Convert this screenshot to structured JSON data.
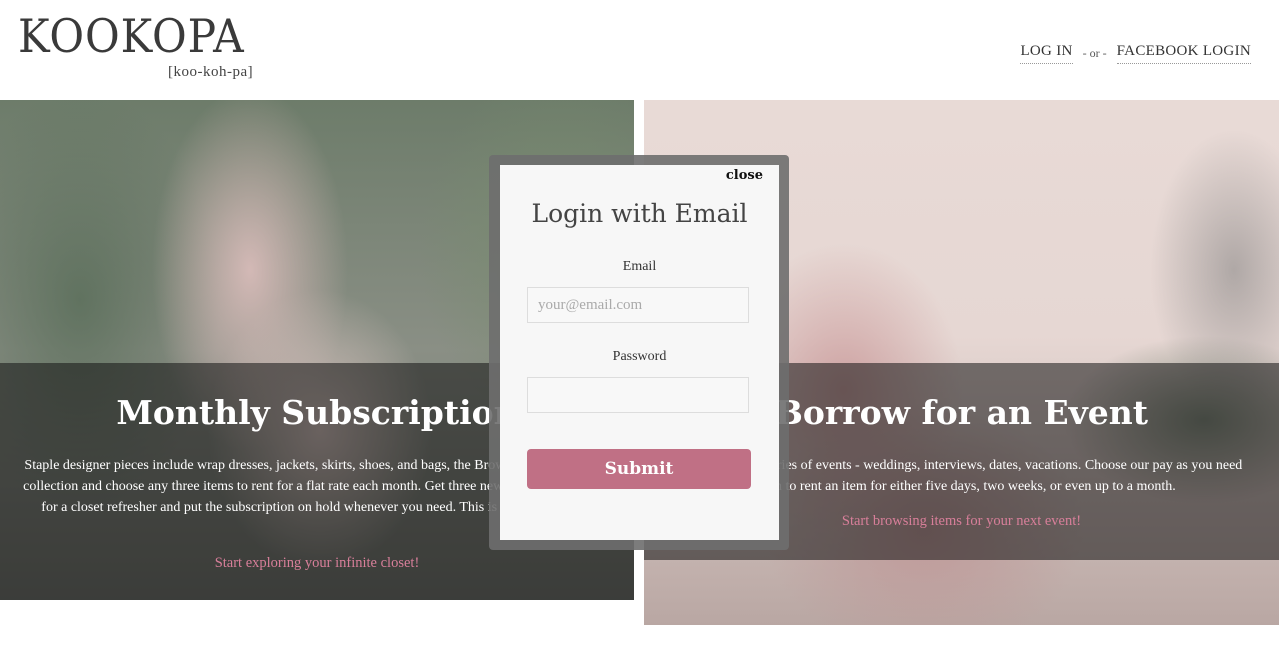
{
  "header": {
    "logo": "KOOKOPA",
    "logo_pronunciation": "[koo-koh-pa]",
    "nav": {
      "login": "LOG IN",
      "or": "- or -",
      "facebook_login": "FACEBOOK LOGIN"
    }
  },
  "panels": {
    "left": {
      "title": "Monthly Subscription",
      "text": "Staple designer pieces include wrap dresses, jackets, skirts, shoes, and bags, the Browse the subscription collection and choose any three items to rent for a flat rate each month. Get three new items every month for a closet refresher and put the subscription on hold whenever you need. This is your new closet.",
      "link": "Start exploring your infinite closet!"
    },
    "right": {
      "title": "Borrow for an Event",
      "text": "Life gives us a series of events - weddings, interviews, dates, vacations. Choose our pay as you need option to rent an item for either five days, two weeks, or even up to a month.",
      "link": "Start browsing items for your next event!"
    }
  },
  "modal": {
    "close": "close",
    "title": "Login with Email",
    "email_label": "Email",
    "email_placeholder": "your@email.com",
    "password_label": "Password",
    "submit": "Submit"
  },
  "colors": {
    "accent": "#c07085",
    "link_pink": "#d87f9a",
    "overlay": "#141414"
  }
}
